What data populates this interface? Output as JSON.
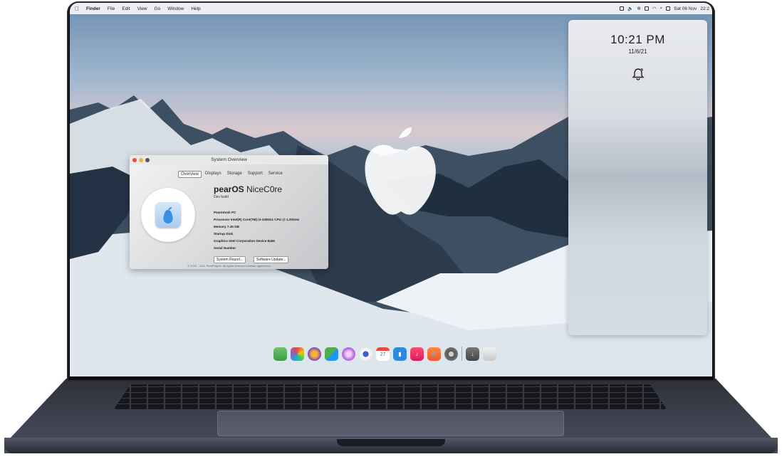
{
  "menubar": {
    "apple_icon": "apple-icon",
    "items": [
      "Finder",
      "File",
      "Edit",
      "View",
      "Go",
      "Window",
      "Help"
    ],
    "date_time": "Sat 06 Nov",
    "clock_short": "22:2"
  },
  "notification_center": {
    "time": "10:21 PM",
    "date": "11/6/21",
    "bell_icon": "bell-icon"
  },
  "system_overview": {
    "title": "System Overview",
    "tabs": [
      "Overview",
      "Displays",
      "Storage",
      "Support",
      "Service"
    ],
    "active_tab": "Overview",
    "os_name_bold": "pearOS",
    "os_name_rest": "NiceC0re",
    "build": "Dev build",
    "specs": [
      "PearIntosh PC",
      "Processor Intel(R) Core(TM) i3-1005G1 CPU @ 1.20GHz",
      "Memory 7.45 GB",
      "Startup Disk",
      "Graphics Intel Corporation Device 8a56",
      "Serial Number"
    ],
    "buttons": {
      "system_report": "System Report...",
      "software_update": "Software Update..."
    },
    "footer": "© 2019 - 2021 PearProject. All rights reserved.License agreement"
  },
  "dock": {
    "calendar_day": "27",
    "icons": [
      "finder-icon",
      "launchpad-icon",
      "firefox-icon",
      "maps-icon",
      "podcasts-icon",
      "camera-icon",
      "calendar-icon",
      "bookmarks-icon",
      "music-icon",
      "store-icon",
      "settings-icon",
      "downloads-icon",
      "trash-icon"
    ]
  },
  "colors": {
    "accent": "#2b6fd6",
    "close": "#e3513f",
    "minimize": "#f0b43c"
  }
}
